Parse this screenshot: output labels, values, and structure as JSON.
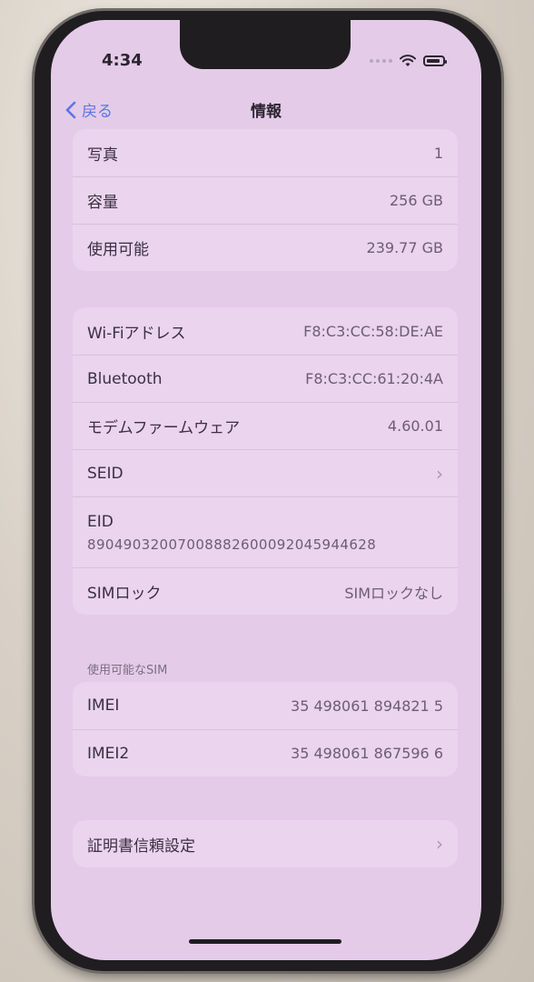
{
  "status_bar": {
    "time": "4:34"
  },
  "nav": {
    "back_label": "戻る",
    "title": "情報"
  },
  "storage": [
    {
      "label": "写真",
      "value": "1"
    },
    {
      "label": "容量",
      "value": "256 GB"
    },
    {
      "label": "使用可能",
      "value": "239.77 GB"
    }
  ],
  "network": {
    "wifi": {
      "label": "Wi-Fiアドレス",
      "value": "F8:C3:CC:58:DE:AE"
    },
    "bluetooth": {
      "label": "Bluetooth",
      "value": "F8:C3:CC:61:20:4A"
    },
    "modem": {
      "label": "モデムファームウェア",
      "value": "4.60.01"
    },
    "seid": {
      "label": "SEID"
    },
    "eid": {
      "label": "EID",
      "value": "89049032007008882600092045944628"
    },
    "simlock": {
      "label": "SIMロック",
      "value": "SIMロックなし"
    }
  },
  "sim": {
    "header": "使用可能なSIM",
    "imei": {
      "label": "IMEI",
      "value": "35 498061 894821 5"
    },
    "imei2": {
      "label": "IMEI2",
      "value": "35 498061 867596 6"
    }
  },
  "certificate": {
    "label": "証明書信頼設定"
  },
  "colors": {
    "accent": "#5a75e6",
    "screen_bg": "#e4cbe8",
    "card_bg": "#ead4ee"
  }
}
